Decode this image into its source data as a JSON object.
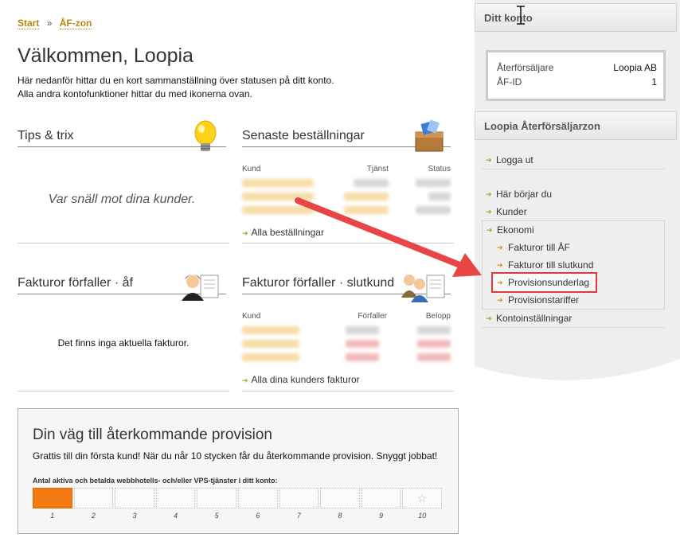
{
  "breadcrumb": {
    "start": "Start",
    "separator": "»",
    "current": "ÅF-zon"
  },
  "page": {
    "title": "Välkommen, Loopia",
    "intro_line1": "Här nedanför hittar du en kort sammanställning över statusen på ditt konto.",
    "intro_line2": "Alla andra kontofunktioner hittar du med ikonerna ovan."
  },
  "tips": {
    "heading": "Tips & trix",
    "text": "Var snäll mot dina kunder."
  },
  "orders": {
    "heading": "Senaste beställningar",
    "columns": [
      "Kund",
      "Tjänst",
      "Status"
    ],
    "link": "Alla beställningar"
  },
  "invoices_af": {
    "heading": "Fakturor förfaller · åf",
    "empty": "Det finns inga aktuella fakturor."
  },
  "invoices_customer": {
    "heading": "Fakturor förfaller · slutkund",
    "columns": [
      "Kund",
      "Förfaller",
      "Belopp"
    ],
    "link": "Alla dina kunders fakturor"
  },
  "provision": {
    "title": "Din väg till återkommande provision",
    "text": "Grattis till din första kund! När du når 10 stycken får du återkommande provision. Snyggt jobbat!",
    "label": "Antal aktiva och betalda webbhotells- och/eller VPS-tjänster i ditt konto:",
    "steps": [
      "1",
      "2",
      "3",
      "4",
      "5",
      "6",
      "7",
      "8",
      "9",
      "10"
    ],
    "filled": 1
  },
  "account": {
    "heading": "Ditt konto",
    "rows": [
      {
        "label": "Återförsäljare",
        "value": "Loopia AB"
      },
      {
        "label": "ÅF-ID",
        "value": "1"
      }
    ]
  },
  "reseller": {
    "heading": "Loopia Återförsäljarzon",
    "logout": "Logga ut",
    "items": [
      "Här börjar du",
      "Kunder",
      "Ekonomi"
    ],
    "economy_sub": [
      "Fakturor till ÅF",
      "Fakturor till slutkund",
      "Provisionsunderlag",
      "Provisionstariffer"
    ],
    "settings": "Kontoinställningar"
  },
  "colors": {
    "accent": "#b8860b",
    "progress": "#f47a14",
    "highlight": "#e03b3b",
    "arrow": "#e84545"
  }
}
